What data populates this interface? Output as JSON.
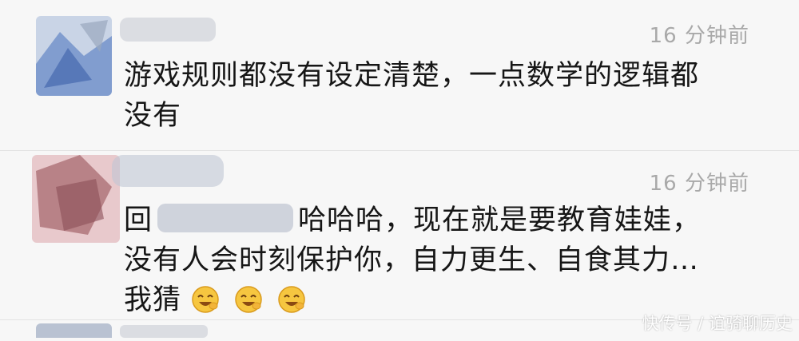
{
  "comments": [
    {
      "time": "16 分钟前",
      "lines": [
        "游戏规则都没有设定清楚，一点数学的逻辑都",
        "没有"
      ]
    },
    {
      "time": "16 分钟前",
      "line1_prefix": "回",
      "line1_rest": "哈哈哈，现在就是要教育娃娃，",
      "line2": "没有人会时刻保护你，自力更生、自食其力…",
      "line3": "我猜",
      "emoji_icons": [
        "laughing-face-icon",
        "laughing-face-icon",
        "laughing-face-icon"
      ]
    }
  ],
  "watermark": "快传号 / 谊骑聊历史",
  "colors": {
    "time": "#a9a9a9",
    "text": "#161616",
    "background": "#f7f7f7"
  }
}
